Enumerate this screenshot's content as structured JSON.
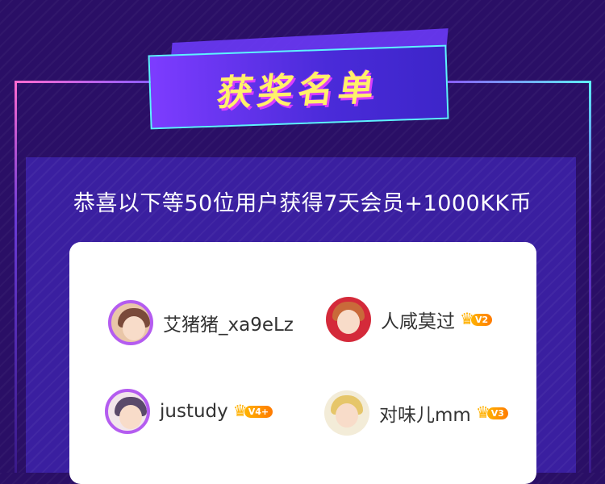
{
  "banner": {
    "title": "获奖名单"
  },
  "subtitle": "恭喜以下等50位用户获得7天会员+1000KK币",
  "colors": {
    "background": "#2a0f66",
    "panel": "#3a1fa0",
    "banner_border": "#5ef2ff",
    "title": "#fff16a",
    "badge": "#ff9a00"
  },
  "winners": [
    {
      "name": "艾猪猪_xa9eLz",
      "level": "",
      "avatar_icon": "user-avatar"
    },
    {
      "name": "人咸莫过",
      "level": "V2",
      "avatar_icon": "user-avatar"
    },
    {
      "name": "justudy",
      "level": "V4+",
      "avatar_icon": "user-avatar"
    },
    {
      "name": "对味儿mm",
      "level": "V3",
      "avatar_icon": "user-avatar"
    }
  ]
}
